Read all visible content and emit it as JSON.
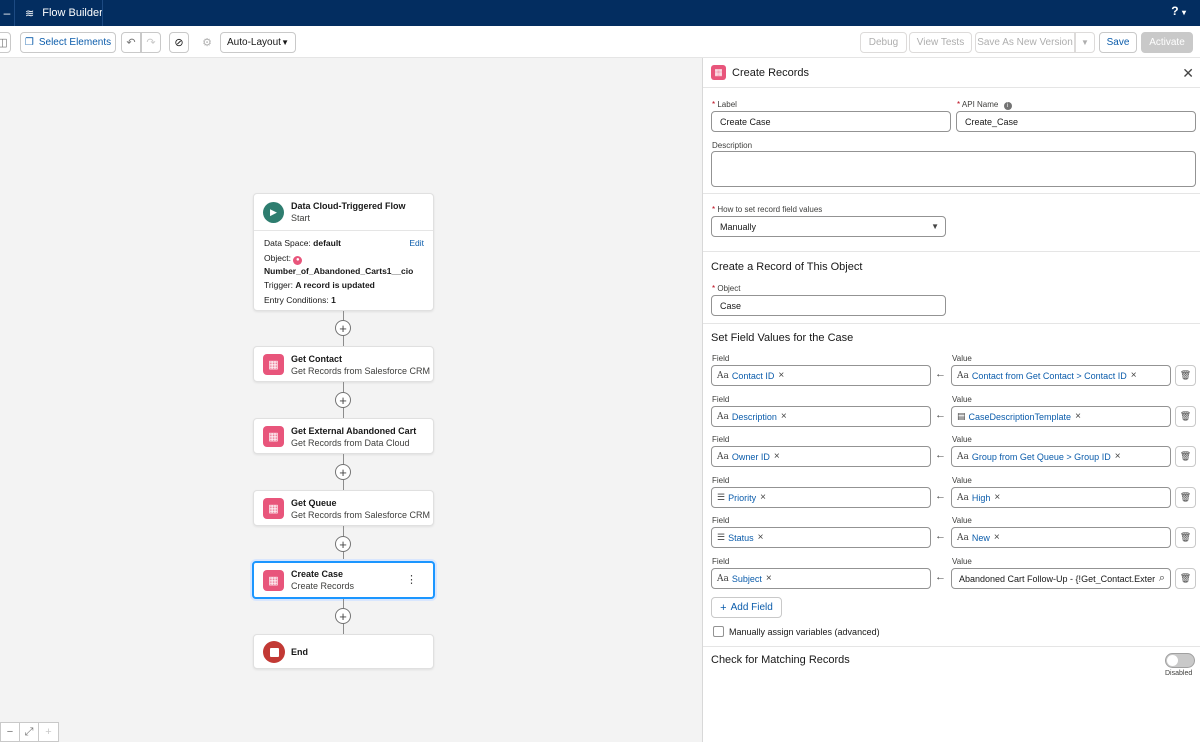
{
  "app": {
    "title": "Flow Builder",
    "help": "?"
  },
  "toolbar": {
    "select_elements": "Select Elements",
    "layout": "Auto-Layout",
    "debug": "Debug",
    "view_tests": "View Tests",
    "save_as_new_version": "Save As New Version",
    "save": "Save",
    "activate": "Activate"
  },
  "canvas": {
    "start": {
      "title": "Data Cloud-Triggered Flow",
      "subtitle": "Start",
      "data_space_label": "Data Space:",
      "data_space_value": "default",
      "edit": "Edit",
      "object_label": "Object:",
      "object_value": "Number_of_Abandoned_Carts1__cio",
      "trigger_label": "Trigger:",
      "trigger_value": "A record is updated",
      "entry_label": "Entry Conditions:",
      "entry_value": "1"
    },
    "nodes": [
      {
        "title": "Get Contact",
        "subtitle": "Get Records from Salesforce CRM"
      },
      {
        "title": "Get External Abandoned Cart",
        "subtitle": "Get Records from Data Cloud"
      },
      {
        "title": "Get Queue",
        "subtitle": "Get Records from Salesforce CRM"
      },
      {
        "title": "Create Case",
        "subtitle": "Create Records"
      }
    ],
    "end": {
      "title": "End"
    }
  },
  "panel": {
    "title": "Create Records",
    "label_label": "Label",
    "label_value": "Create Case",
    "api_name_label": "API Name",
    "api_name_value": "Create_Case",
    "description_label": "Description",
    "how_label": "How to set record field values",
    "how_value": "Manually",
    "create_section": "Create a Record of This Object",
    "object_label": "Object",
    "object_value": "Case",
    "set_values_section": "Set Field Values for the Case",
    "field_col": "Field",
    "value_col": "Value",
    "rows": [
      {
        "field": "Contact ID",
        "value": "Contact from Get Contact > Contact ID"
      },
      {
        "field": "Description",
        "value": "CaseDescriptionTemplate"
      },
      {
        "field": "Owner ID",
        "value": "Group from Get Queue > Group ID"
      },
      {
        "field": "Priority",
        "value": "High"
      },
      {
        "field": "Status",
        "value": "New"
      },
      {
        "field": "Subject",
        "value": "Abandoned Cart Follow-Up - {!Get_Contact.Exter"
      }
    ],
    "add_field": "Add Field",
    "manual_assign": "Manually assign variables (advanced)",
    "matching_section": "Check for Matching Records",
    "toggle_state": "Disabled"
  }
}
